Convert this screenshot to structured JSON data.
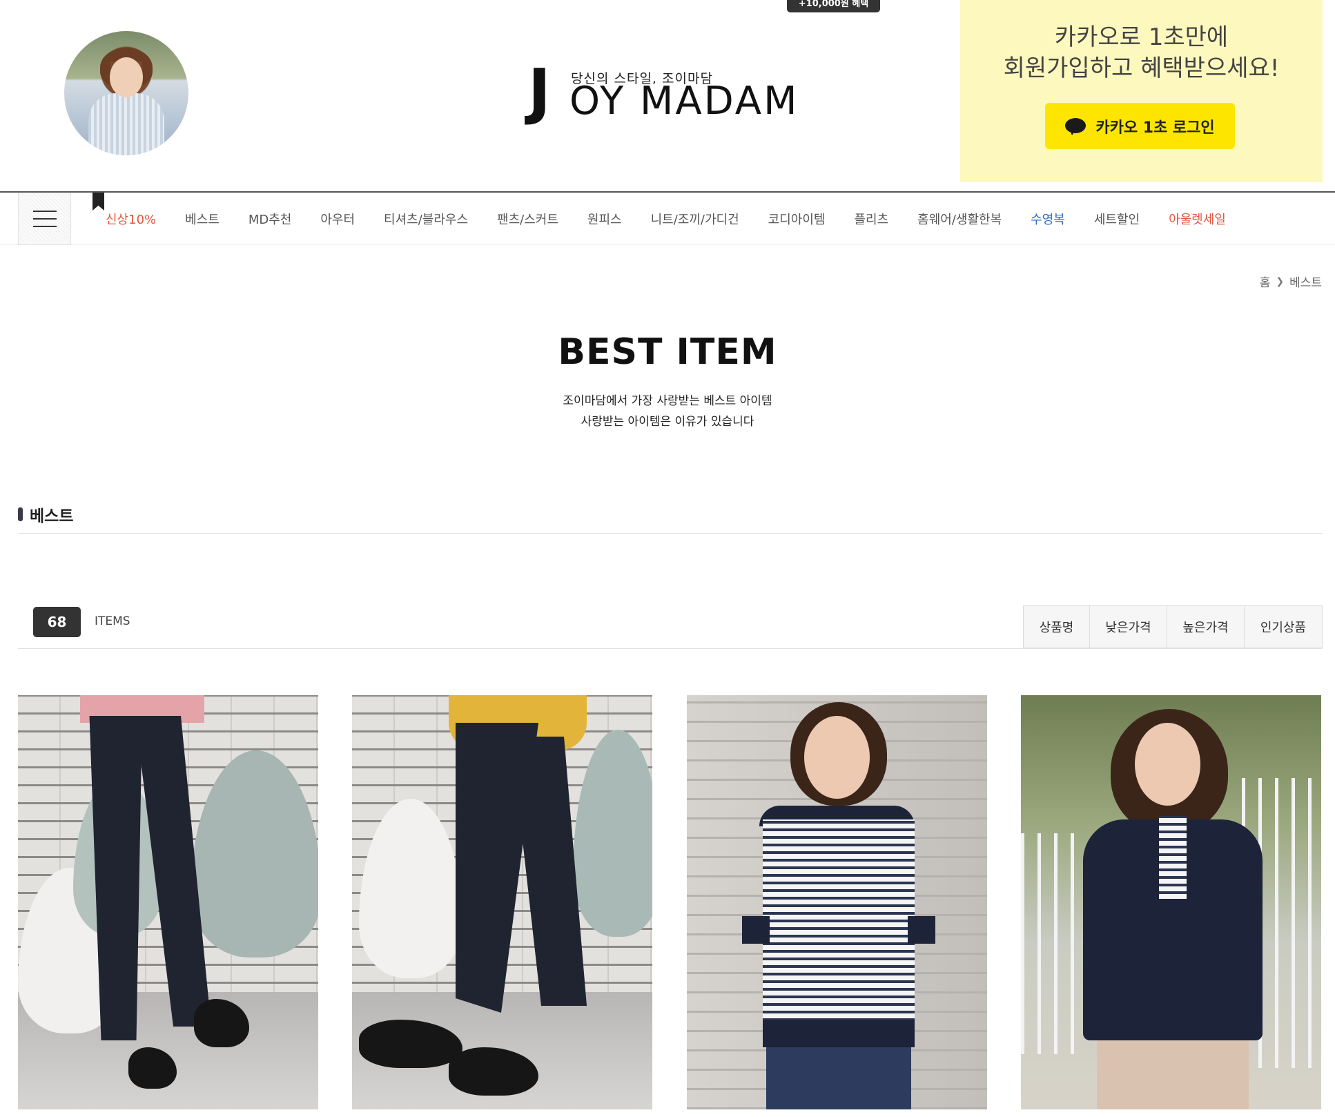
{
  "header": {
    "promo_badge": "+10,000원 혜택",
    "logo": {
      "slogan": "당신의 스타일, 조이마담",
      "first_letter": "J",
      "rest": "OY MADAM"
    },
    "kakao": {
      "line1": "카카오로 1초만에",
      "line2": "회원가입하고 혜택받으세요!",
      "button_label": "카카오 1초 로그인",
      "bg_color": "#fdf8bd",
      "button_color": "#fee500"
    }
  },
  "nav": {
    "items": [
      {
        "label": "신상10%",
        "color": "red"
      },
      {
        "label": "베스트"
      },
      {
        "label": "MD추천"
      },
      {
        "label": "아우터"
      },
      {
        "label": "티셔츠/블라우스"
      },
      {
        "label": "팬츠/스커트"
      },
      {
        "label": "원피스"
      },
      {
        "label": "니트/조끼/가디건"
      },
      {
        "label": "코디아이템"
      },
      {
        "label": "플리츠"
      },
      {
        "label": "홈웨어/생활한복"
      },
      {
        "label": "수영복",
        "color": "blue"
      },
      {
        "label": "세트할인"
      },
      {
        "label": "아울렛세일",
        "color": "red"
      }
    ]
  },
  "breadcrumb": {
    "home": "홈",
    "current": "베스트"
  },
  "hero": {
    "title": "BEST ITEM",
    "line1": "조이마담에서 가장 사랑받는 베스트 아이템",
    "line2": "사랑받는 아이템은 이유가 있습니다"
  },
  "section": {
    "title": "베스트"
  },
  "listing": {
    "count": "68",
    "count_label": "ITEMS",
    "sort_options": [
      "상품명",
      "낮은가격",
      "높은가격",
      "인기상품"
    ]
  },
  "products": [
    {
      "image": "black-slim-pants-photo"
    },
    {
      "image": "navy-cropped-pants-photo"
    },
    {
      "image": "striped-tshirt-photo"
    },
    {
      "image": "navy-collar-blouse-photo"
    }
  ]
}
